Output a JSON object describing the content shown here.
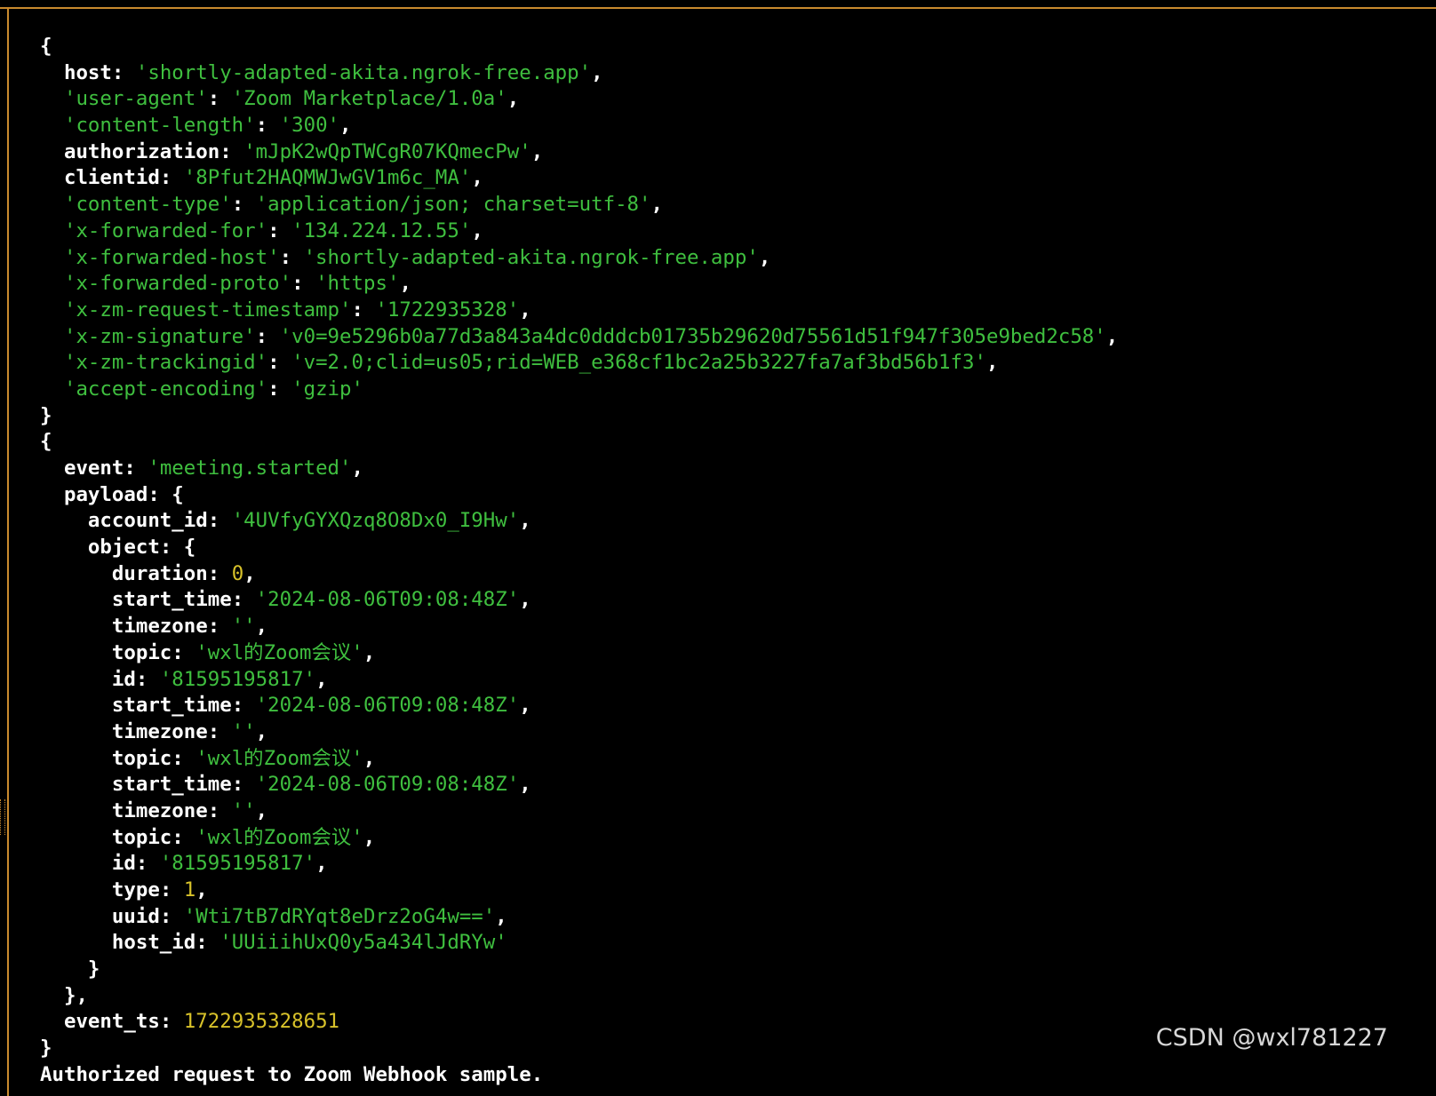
{
  "colors": {
    "background": "#000000",
    "key": "#ffffff",
    "string": "#3fbf3f",
    "number": "#d8c22a",
    "window_border": "#c98a2e"
  },
  "lines": [
    [
      {
        "c": "p",
        "t": "{"
      }
    ],
    [
      {
        "c": "k",
        "t": "  host"
      },
      {
        "c": "p",
        "t": ": "
      },
      {
        "c": "s",
        "t": "'shortly-adapted-akita.ngrok-free.app'"
      },
      {
        "c": "p",
        "t": ","
      }
    ],
    [
      {
        "c": "q",
        "t": "  'user-agent'"
      },
      {
        "c": "p",
        "t": ": "
      },
      {
        "c": "s",
        "t": "'Zoom Marketplace/1.0a'"
      },
      {
        "c": "p",
        "t": ","
      }
    ],
    [
      {
        "c": "q",
        "t": "  'content-length'"
      },
      {
        "c": "p",
        "t": ": "
      },
      {
        "c": "s",
        "t": "'300'"
      },
      {
        "c": "p",
        "t": ","
      }
    ],
    [
      {
        "c": "k",
        "t": "  authorization"
      },
      {
        "c": "p",
        "t": ": "
      },
      {
        "c": "s",
        "t": "'mJpK2wQpTWCgR07KQmecPw'"
      },
      {
        "c": "p",
        "t": ","
      }
    ],
    [
      {
        "c": "k",
        "t": "  clientid"
      },
      {
        "c": "p",
        "t": ": "
      },
      {
        "c": "s",
        "t": "'8Pfut2HAQMWJwGV1m6c_MA'"
      },
      {
        "c": "p",
        "t": ","
      }
    ],
    [
      {
        "c": "q",
        "t": "  'content-type'"
      },
      {
        "c": "p",
        "t": ": "
      },
      {
        "c": "s",
        "t": "'application/json; charset=utf-8'"
      },
      {
        "c": "p",
        "t": ","
      }
    ],
    [
      {
        "c": "q",
        "t": "  'x-forwarded-for'"
      },
      {
        "c": "p",
        "t": ": "
      },
      {
        "c": "s",
        "t": "'134.224.12.55'"
      },
      {
        "c": "p",
        "t": ","
      }
    ],
    [
      {
        "c": "q",
        "t": "  'x-forwarded-host'"
      },
      {
        "c": "p",
        "t": ": "
      },
      {
        "c": "s",
        "t": "'shortly-adapted-akita.ngrok-free.app'"
      },
      {
        "c": "p",
        "t": ","
      }
    ],
    [
      {
        "c": "q",
        "t": "  'x-forwarded-proto'"
      },
      {
        "c": "p",
        "t": ": "
      },
      {
        "c": "s",
        "t": "'https'"
      },
      {
        "c": "p",
        "t": ","
      }
    ],
    [
      {
        "c": "q",
        "t": "  'x-zm-request-timestamp'"
      },
      {
        "c": "p",
        "t": ": "
      },
      {
        "c": "s",
        "t": "'1722935328'"
      },
      {
        "c": "p",
        "t": ","
      }
    ],
    [
      {
        "c": "q",
        "t": "  'x-zm-signature'"
      },
      {
        "c": "p",
        "t": ": "
      },
      {
        "c": "s",
        "t": "'v0=9e5296b0a77d3a843a4dc0dddcb01735b29620d75561d51f947f305e9bed2c58'"
      },
      {
        "c": "p",
        "t": ","
      }
    ],
    [
      {
        "c": "q",
        "t": "  'x-zm-trackingid'"
      },
      {
        "c": "p",
        "t": ": "
      },
      {
        "c": "s",
        "t": "'v=2.0;clid=us05;rid=WEB_e368cf1bc2a25b3227fa7af3bd56b1f3'"
      },
      {
        "c": "p",
        "t": ","
      }
    ],
    [
      {
        "c": "q",
        "t": "  'accept-encoding'"
      },
      {
        "c": "p",
        "t": ": "
      },
      {
        "c": "s",
        "t": "'gzip'"
      }
    ],
    [
      {
        "c": "p",
        "t": "}"
      }
    ],
    [
      {
        "c": "p",
        "t": "{"
      }
    ],
    [
      {
        "c": "k",
        "t": "  event"
      },
      {
        "c": "p",
        "t": ": "
      },
      {
        "c": "s",
        "t": "'meeting.started'"
      },
      {
        "c": "p",
        "t": ","
      }
    ],
    [
      {
        "c": "k",
        "t": "  payload"
      },
      {
        "c": "p",
        "t": ": {"
      }
    ],
    [
      {
        "c": "k",
        "t": "    account_id"
      },
      {
        "c": "p",
        "t": ": "
      },
      {
        "c": "s",
        "t": "'4UVfyGYXQzq8O8Dx0_I9Hw'"
      },
      {
        "c": "p",
        "t": ","
      }
    ],
    [
      {
        "c": "k",
        "t": "    object"
      },
      {
        "c": "p",
        "t": ": {"
      }
    ],
    [
      {
        "c": "k",
        "t": "      duration"
      },
      {
        "c": "p",
        "t": ": "
      },
      {
        "c": "n",
        "t": "0"
      },
      {
        "c": "p",
        "t": ","
      }
    ],
    [
      {
        "c": "k",
        "t": "      start_time"
      },
      {
        "c": "p",
        "t": ": "
      },
      {
        "c": "s",
        "t": "'2024-08-06T09:08:48Z'"
      },
      {
        "c": "p",
        "t": ","
      }
    ],
    [
      {
        "c": "k",
        "t": "      timezone"
      },
      {
        "c": "p",
        "t": ": "
      },
      {
        "c": "s",
        "t": "''"
      },
      {
        "c": "p",
        "t": ","
      }
    ],
    [
      {
        "c": "k",
        "t": "      topic"
      },
      {
        "c": "p",
        "t": ": "
      },
      {
        "c": "s",
        "t": "'wxl的Zoom会议'"
      },
      {
        "c": "p",
        "t": ","
      }
    ],
    [
      {
        "c": "k",
        "t": "      id"
      },
      {
        "c": "p",
        "t": ": "
      },
      {
        "c": "s",
        "t": "'81595195817'"
      },
      {
        "c": "p",
        "t": ","
      }
    ],
    [
      {
        "c": "k",
        "t": "      start_time"
      },
      {
        "c": "p",
        "t": ": "
      },
      {
        "c": "s",
        "t": "'2024-08-06T09:08:48Z'"
      },
      {
        "c": "p",
        "t": ","
      }
    ],
    [
      {
        "c": "k",
        "t": "      timezone"
      },
      {
        "c": "p",
        "t": ": "
      },
      {
        "c": "s",
        "t": "''"
      },
      {
        "c": "p",
        "t": ","
      }
    ],
    [
      {
        "c": "k",
        "t": "      topic"
      },
      {
        "c": "p",
        "t": ": "
      },
      {
        "c": "s",
        "t": "'wxl的Zoom会议'"
      },
      {
        "c": "p",
        "t": ","
      }
    ],
    [
      {
        "c": "k",
        "t": "      start_time"
      },
      {
        "c": "p",
        "t": ": "
      },
      {
        "c": "s",
        "t": "'2024-08-06T09:08:48Z'"
      },
      {
        "c": "p",
        "t": ","
      }
    ],
    [
      {
        "c": "k",
        "t": "      timezone"
      },
      {
        "c": "p",
        "t": ": "
      },
      {
        "c": "s",
        "t": "''"
      },
      {
        "c": "p",
        "t": ","
      }
    ],
    [
      {
        "c": "k",
        "t": "      topic"
      },
      {
        "c": "p",
        "t": ": "
      },
      {
        "c": "s",
        "t": "'wxl的Zoom会议'"
      },
      {
        "c": "p",
        "t": ","
      }
    ],
    [
      {
        "c": "k",
        "t": "      id"
      },
      {
        "c": "p",
        "t": ": "
      },
      {
        "c": "s",
        "t": "'81595195817'"
      },
      {
        "c": "p",
        "t": ","
      }
    ],
    [
      {
        "c": "k",
        "t": "      type"
      },
      {
        "c": "p",
        "t": ": "
      },
      {
        "c": "n",
        "t": "1"
      },
      {
        "c": "p",
        "t": ","
      }
    ],
    [
      {
        "c": "k",
        "t": "      uuid"
      },
      {
        "c": "p",
        "t": ": "
      },
      {
        "c": "s",
        "t": "'Wti7tB7dRYqt8eDrz2oG4w=='"
      },
      {
        "c": "p",
        "t": ","
      }
    ],
    [
      {
        "c": "k",
        "t": "      host_id"
      },
      {
        "c": "p",
        "t": ": "
      },
      {
        "c": "s",
        "t": "'UUiiihUxQ0y5a434lJdRYw'"
      }
    ],
    [
      {
        "c": "p",
        "t": "    }"
      }
    ],
    [
      {
        "c": "p",
        "t": "  },"
      }
    ],
    [
      {
        "c": "k",
        "t": "  event_ts"
      },
      {
        "c": "p",
        "t": ": "
      },
      {
        "c": "n",
        "t": "1722935328651"
      }
    ],
    [
      {
        "c": "p",
        "t": "}"
      }
    ],
    [
      {
        "c": "t",
        "t": "Authorized request to Zoom Webhook sample."
      }
    ]
  ],
  "watermark": "CSDN @wxl781227"
}
